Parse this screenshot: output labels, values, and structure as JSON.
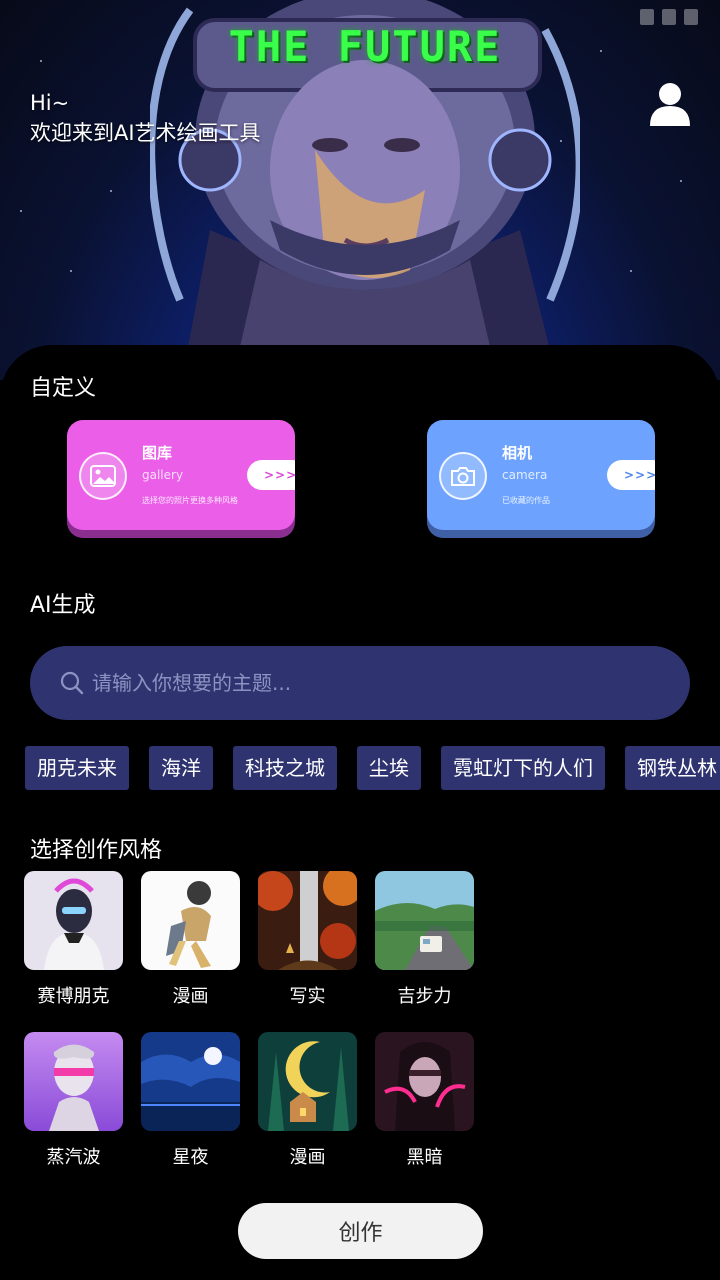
{
  "hero": {
    "banner_text": "THE FUTURE",
    "greeting_line1": "Hi~",
    "greeting_line2": "欢迎来到AI艺术绘画工具",
    "user_icon": "user-icon"
  },
  "custom": {
    "title": "自定义",
    "gallery": {
      "title": "图库",
      "subtitle": "gallery",
      "desc": "选择您的照片更换多种风格",
      "arrow": ">>>",
      "icon": "image-icon",
      "color": "#ea5ee8"
    },
    "camera": {
      "title": "相机",
      "subtitle": "camera",
      "desc": "已收藏的作品",
      "arrow": ">>>",
      "icon": "camera-icon",
      "color": "#6da3ff"
    }
  },
  "ai": {
    "title": "AI生成",
    "search_placeholder": "请输入你想要的主题...",
    "tags": [
      "朋克未来",
      "海洋",
      "科技之城",
      "尘埃",
      "霓虹灯下的人们",
      "钢铁丛林"
    ]
  },
  "styles": {
    "title": "选择创作风格",
    "items": [
      {
        "label": "赛博朋克"
      },
      {
        "label": "漫画"
      },
      {
        "label": "写实"
      },
      {
        "label": "吉步力"
      },
      {
        "label": "蒸汽波"
      },
      {
        "label": "星夜"
      },
      {
        "label": "漫画"
      },
      {
        "label": "黑暗"
      }
    ]
  },
  "create_button": "创作",
  "colors": {
    "accent_surface": "#2f3470",
    "panel_bg": "#000000"
  }
}
